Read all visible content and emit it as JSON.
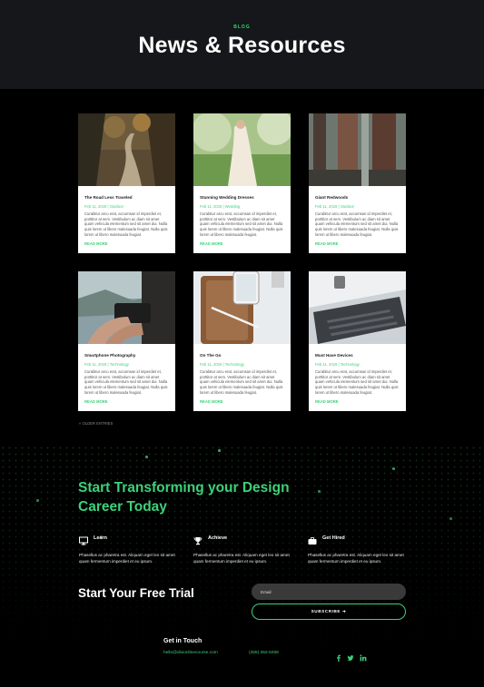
{
  "hero": {
    "eyebrow": "BLOG",
    "title": "News & Resources"
  },
  "posts": [
    {
      "title": "The Road Less Traveled",
      "meta": "Feb 11, 2019 | Outdoor",
      "excerpt": "Curabitur arcu erat, accumsan id imperdiet et, porttitor at sem. Vestibulum ac diam sit amet quam vehicula elementum sed sit amet dui. Nulla quis lorem ut libero malesuada feugiat. Nulla quis lorem ut libero malesuada feugiat.",
      "more": "READ MORE"
    },
    {
      "title": "Stunning Wedding Dresses",
      "meta": "Feb 11, 2019 | Wedding",
      "excerpt": "Curabitur arcu erat, accumsan id imperdiet et, porttitor at sem. Vestibulum ac diam sit amet quam vehicula elementum sed sit amet dui. Nulla quis lorem ut libero malesuada feugiat. Nulla quis lorem ut libero malesuada feugiat.",
      "more": "READ MORE"
    },
    {
      "title": "Giant Redwoods",
      "meta": "Feb 11, 2019 | Outdoor",
      "excerpt": "Curabitur arcu erat, accumsan id imperdiet et, porttitor at sem. Vestibulum ac diam sit amet quam vehicula elementum sed sit amet dui. Nulla quis lorem ut libero malesuada feugiat. Nulla quis lorem ut libero malesuada feugiat.",
      "more": "READ MORE"
    },
    {
      "title": "Smartphone Photography",
      "meta": "Feb 11, 2019 | Technology",
      "excerpt": "Curabitur arcu erat, accumsan id imperdiet et, porttitor at sem. Vestibulum ac diam sit amet quam vehicula elementum sed sit amet dui. Nulla quis lorem ut libero malesuada feugiat. Nulla quis lorem ut libero malesuada feugiat.",
      "more": "READ MORE"
    },
    {
      "title": "On The Go",
      "meta": "Feb 11, 2019 | Technology",
      "excerpt": "Curabitur arcu erat, accumsan id imperdiet et, porttitor at sem. Vestibulum ac diam sit amet quam vehicula elementum sed sit amet dui. Nulla quis lorem ut libero malesuada feugiat. Nulla quis lorem ut libero malesuada feugiat.",
      "more": "READ MORE"
    },
    {
      "title": "Must Have Devices",
      "meta": "Feb 11, 2019 | Technology",
      "excerpt": "Curabitur arcu erat, accumsan id imperdiet et, porttitor at sem. Vestibulum ac diam sit amet quam vehicula elementum sed sit amet dui. Nulla quis lorem ut libero malesuada feugiat. Nulla quis lorem ut libero malesuada feugiat.",
      "more": "READ MORE"
    }
  ],
  "older_entries": "« OLDER ENTRIES",
  "cta": {
    "heading": "Start Transforming your Design Career Today",
    "features": [
      {
        "icon": "monitor-icon",
        "label": "Learn",
        "desc": "Phasellus ac pharetra est. Aliquam eget leo sit amet quam fermentum imperdiet et eu ipsum."
      },
      {
        "icon": "trophy-icon",
        "label": "Achieve",
        "desc": "Phasellus ac pharetra est. Aliquam eget leo sit amet quam fermentum imperdiet et eu ipsum."
      },
      {
        "icon": "briefcase-icon",
        "label": "Get Hired",
        "desc": "Phasellus ac pharetra est. Aliquam eget leo sit amet quam fermentum imperdiet et eu ipsum."
      }
    ],
    "trial_title": "Start Your Free Trial",
    "email_placeholder": "Email",
    "subscribe_label": "SUBSCRIBE ➜"
  },
  "footer": {
    "title": "Get in Touch",
    "email": "hello@divionlinecourse.com",
    "phone": "(255) 352-6258",
    "social": [
      "facebook-icon",
      "twitter-icon",
      "linkedin-icon"
    ]
  },
  "colors": {
    "accent": "#3ed07a",
    "hero_bg": "#15171a",
    "page_bg": "#000000"
  }
}
